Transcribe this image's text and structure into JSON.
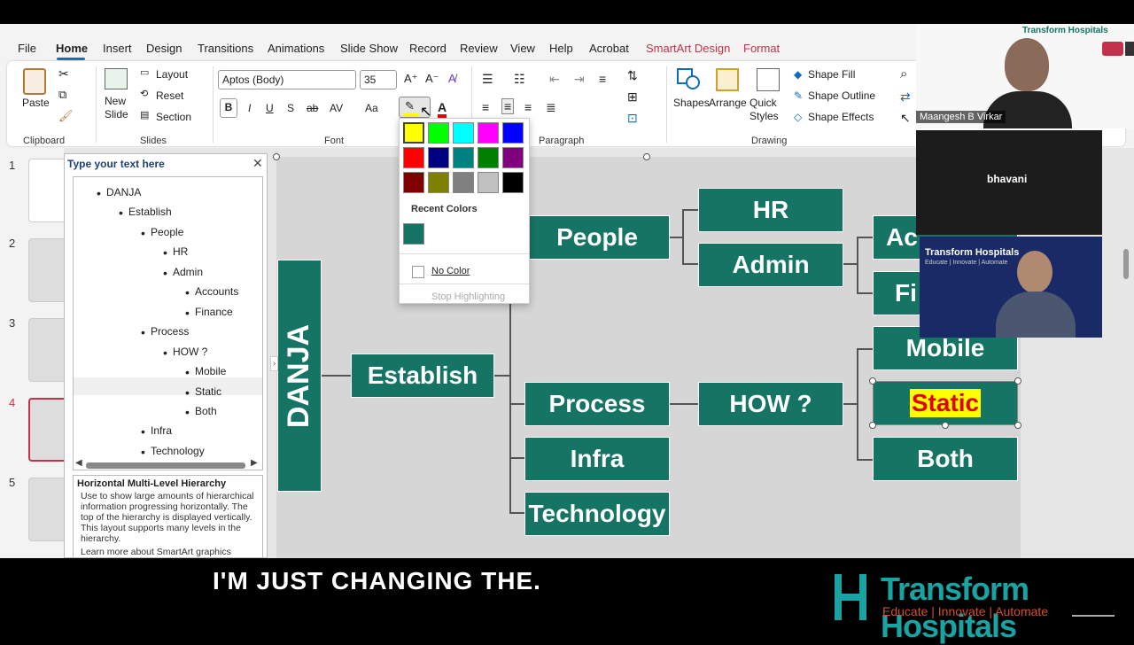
{
  "menu": {
    "tabs": [
      "File",
      "Home",
      "Insert",
      "Design",
      "Transitions",
      "Animations",
      "Slide Show",
      "Record",
      "Review",
      "View",
      "Help",
      "Acrobat",
      "SmartArt Design",
      "Format"
    ]
  },
  "ribbon": {
    "paste": "Paste",
    "new_slide": "New\nSlide",
    "layout": "Layout",
    "reset": "Reset",
    "section": "Section",
    "clipboard": "Clipboard",
    "slides": "Slides",
    "font_group": "Font",
    "paragraph_group": "Paragraph",
    "drawing_group": "Drawing",
    "font_name": "Aptos (Body)",
    "font_size": "35",
    "shapes": "Shapes",
    "arrange": "Arrange",
    "quick_styles": "Quick\nStyles",
    "shape_fill": "Shape Fill",
    "shape_outline": "Shape Outline",
    "shape_effects": "Shape Effects"
  },
  "slide_numbers": [
    "1",
    "2",
    "3",
    "4",
    "5"
  ],
  "text_pane": {
    "title": "Type your text here",
    "items": [
      "DANJA",
      "Establish",
      "People",
      "HR",
      "Admin",
      "Accounts",
      "Finance",
      "Process",
      "HOW ?",
      "Mobile",
      "Static",
      "Both",
      "Infra",
      "Technology"
    ],
    "desc_title": "Horizontal Multi-Level Hierarchy",
    "desc": "Use to show large amounts of hierarchical information progressing horizontally. The top of the hierarchy is displayed vertically. This layout supports many levels in the hierarchy.",
    "learn_more": "Learn more about SmartArt graphics"
  },
  "smartart": {
    "root": "DANJA",
    "establish": "Establish",
    "people": "People",
    "hr": "HR",
    "admin": "Admin",
    "accounts": "Ac",
    "finance": "Fi",
    "process": "Process",
    "how": "HOW ?",
    "mobile": "Mobile",
    "static": "Static",
    "both": "Both",
    "infra": "Infra",
    "technology": "Technology"
  },
  "color_picker": {
    "swatches": [
      "#ffff00",
      "#00ff00",
      "#00ffff",
      "#ff00ff",
      "#0000ff",
      "#ff0000",
      "#000080",
      "#008080",
      "#008000",
      "#800080",
      "#800000",
      "#808000",
      "#808080",
      "#c0c0c0",
      "#000000"
    ],
    "recent_label": "Recent Colors",
    "recent_color": "#157463",
    "no_color": "No Color",
    "stop_highlighting": "Stop Highlighting"
  },
  "video": {
    "speaker_name": "Maangesh B Virkar",
    "participant": "bhavani",
    "brand": "Transform Hospitals",
    "tagline": "Educate | Innovate | Automate"
  },
  "caption": {
    "text": "I'M JUST CHANGING THE."
  },
  "logo": {
    "name": "Transform Hospitals",
    "tagline": "Educate | Innovate | Automate"
  }
}
